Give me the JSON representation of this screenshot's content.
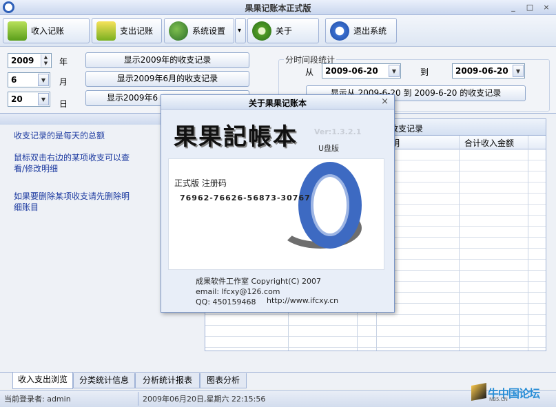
{
  "window": {
    "title": "果果记账本正式版",
    "min": "_",
    "max": "□",
    "close": "×"
  },
  "toolbar": {
    "income": "收入记账",
    "expense": "支出记账",
    "settings": "系统设置",
    "settings_dropdown": "▾",
    "about": "关于",
    "exit": "退出系统"
  },
  "controls": {
    "year": "2009",
    "year_unit": "年",
    "month": "6",
    "month_unit": "月",
    "day": "20",
    "day_unit": "日",
    "btn_year": "显示2009年的收支记录",
    "btn_month": "显示2009年6月的收支记录",
    "btn_day": "显示2009年6",
    "period_legend": "分时间段统计",
    "from_label": "从",
    "from_date": "2009-06-20",
    "to_label": "到",
    "to_date": "2009-06-20",
    "btn_period": "显示从 2009-6-20 到 2009-6-20 的收支记录"
  },
  "left_info": [
    "收支记录的是每天的总额",
    "鼠标双击右边的某项收支可以查看/修改明细",
    "如果要删除某项收支请先删除明细账目"
  ],
  "grid": {
    "caption": "收支记录",
    "columns": [
      "明",
      "合计收入金额"
    ]
  },
  "tabs": [
    "收入支出浏览",
    "分类统计信息",
    "分析统计报表",
    "图表分析"
  ],
  "status": {
    "user": "当前登录者: admin",
    "datetime": "2009年06月20日,星期六 22:15:56"
  },
  "watermark": {
    "main": "牛中国论坛",
    "sub": "NB5.CN"
  },
  "about_dialog": {
    "title": "关于果果记账本",
    "close": "×",
    "logo": "果果記帳本",
    "version": "Ver:1.3.2.1",
    "edition": "U盘版",
    "reg_label": "正式版 注册码",
    "reg_code": "76962-76626-56873-30767",
    "studio": "成果软件工作室 Copyright(C) 2007",
    "email": "email: lfcxy@126.com",
    "qq": "QQ: 450159468",
    "url": "http://www.ifcxy.cn"
  }
}
